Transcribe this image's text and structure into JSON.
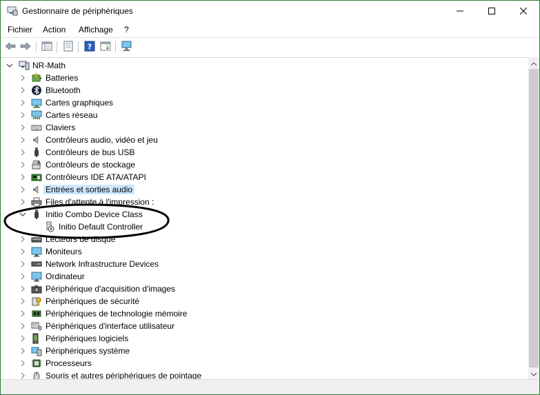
{
  "window": {
    "title": "Gestionnaire de périphériques"
  },
  "menu": {
    "items": [
      {
        "label": "Fichier"
      },
      {
        "label": "Action"
      },
      {
        "label": "Affichage"
      },
      {
        "label": "?"
      }
    ]
  },
  "tree": {
    "root": {
      "label": "NR-Math",
      "icon": "computer-icon"
    },
    "items": [
      {
        "label": "Batteries",
        "icon": "battery-icon",
        "expanded": false
      },
      {
        "label": "Bluetooth",
        "icon": "bluetooth-icon",
        "expanded": false
      },
      {
        "label": "Cartes graphiques",
        "icon": "display-adapter-icon",
        "expanded": false
      },
      {
        "label": "Cartes réseau",
        "icon": "network-adapter-icon",
        "expanded": false
      },
      {
        "label": "Claviers",
        "icon": "keyboard-icon",
        "expanded": false
      },
      {
        "label": "Contrôleurs audio, vidéo et jeu",
        "icon": "speaker-icon",
        "expanded": false
      },
      {
        "label": "Contrôleurs de bus USB",
        "icon": "usb-icon",
        "expanded": false
      },
      {
        "label": "Contrôleurs de stockage",
        "icon": "storage-controller-icon",
        "expanded": false
      },
      {
        "label": "Contrôleurs IDE ATA/ATAPI",
        "icon": "ide-controller-icon",
        "expanded": false
      },
      {
        "label": "Entrées et sorties audio",
        "icon": "speaker-icon",
        "expanded": false,
        "selected": true
      },
      {
        "label": "Files d'attente à l'impression :",
        "icon": "printer-icon",
        "expanded": false
      },
      {
        "label": "Initio Combo Device Class",
        "icon": "usb-icon",
        "expanded": true
      },
      {
        "label": "Initio Default Controller",
        "icon": "usb-warning-icon",
        "child": true
      },
      {
        "label": "Lecteurs de disque",
        "icon": "disk-drive-icon",
        "expanded": false
      },
      {
        "label": "Moniteurs",
        "icon": "monitor-icon",
        "expanded": false
      },
      {
        "label": "Network Infrastructure Devices",
        "icon": "network-infrastructure-icon",
        "expanded": false
      },
      {
        "label": "Ordinateur",
        "icon": "monitor-icon",
        "expanded": false
      },
      {
        "label": "Périphérique d'acquisition d'images",
        "icon": "camera-icon",
        "expanded": false
      },
      {
        "label": "Périphériques de sécurité",
        "icon": "security-device-icon",
        "expanded": false
      },
      {
        "label": "Périphériques de technologie mémoire",
        "icon": "memory-icon",
        "expanded": false
      },
      {
        "label": "Périphériques d'interface utilisateur",
        "icon": "hid-icon",
        "expanded": false
      },
      {
        "label": "Périphériques logiciels",
        "icon": "software-device-icon",
        "expanded": false
      },
      {
        "label": "Périphériques système",
        "icon": "system-device-icon",
        "expanded": false
      },
      {
        "label": "Processeurs",
        "icon": "processor-icon",
        "expanded": false
      },
      {
        "label": "Souris et autres périphériques de pointage",
        "icon": "mouse-icon",
        "expanded": false
      }
    ]
  },
  "colors": {
    "selection": "#cce8ff",
    "window_border": "#2d7d3a",
    "annotation": "#000000"
  }
}
